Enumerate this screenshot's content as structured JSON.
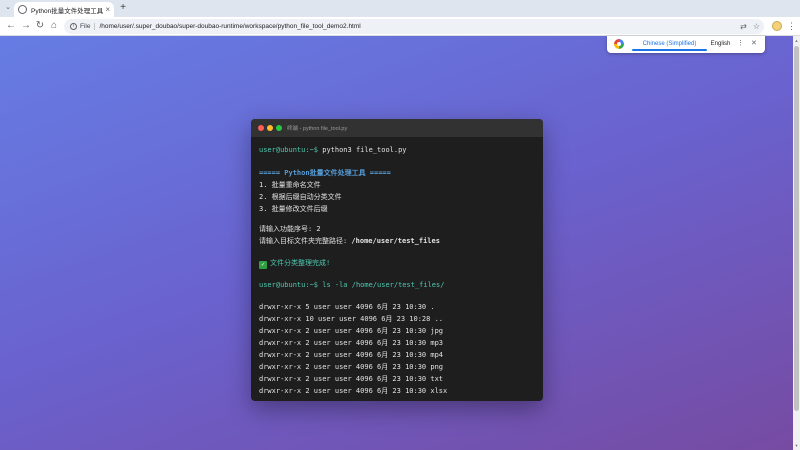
{
  "browser": {
    "tab": {
      "title": "Python批量文件处理工具 - 演",
      "close": "×"
    },
    "new_tab": "+",
    "omnibox": {
      "chip": "File",
      "url": "/home/user/.super_doubao/super-doubao-runtime/workspace/python_file_tool_demo2.html"
    }
  },
  "translate_popup": {
    "source_language": "Chinese (Simplified)",
    "target_language": "English"
  },
  "terminal": {
    "title": "终端 - python file_tool.py",
    "lines": {
      "l1_prompt": "user@ubuntu:~$",
      "l1_cmd": " python3 file_tool.py",
      "l2": "===== Python批量文件处理工具 =====",
      "l3": "1. 批量重命名文件",
      "l4": "2. 根据后缀自动分类文件",
      "l5": "3. 批量修改文件后缀",
      "l6": "请输入功能序号: 2",
      "l7_label": "请输入目标文件夹完整路径:",
      "l7_value": " /home/user/test_files",
      "l8_text": "文件分类整理完成!",
      "l9_prompt": "user@ubuntu:~$",
      "l9_cmd": " ls -la /home/user/test_files/",
      "listing": [
        "drwxr-xr-x 5 user user 4096 6月 23 10:30 .",
        "drwxr-xr-x 10 user user 4096 6月 23 10:28 ..",
        "drwxr-xr-x 2 user user 4096 6月 23 10:30 jpg",
        "drwxr-xr-x 2 user user 4096 6月 23 10:30 mp3",
        "drwxr-xr-x 2 user user 4096 6月 23 10:30 mp4",
        "drwxr-xr-x 2 user user 4096 6月 23 10:30 png",
        "drwxr-xr-x 2 user user 4096 6月 23 10:30 txt",
        "drwxr-xr-x 2 user user 4096 6月 23 10:30 xlsx"
      ]
    }
  },
  "colors": {
    "gradient_start": "#667de4",
    "gradient_end": "#764ba2",
    "terminal_bg": "#1e1e1e",
    "prompt": "#4ec9b0",
    "header": "#569cd6"
  }
}
